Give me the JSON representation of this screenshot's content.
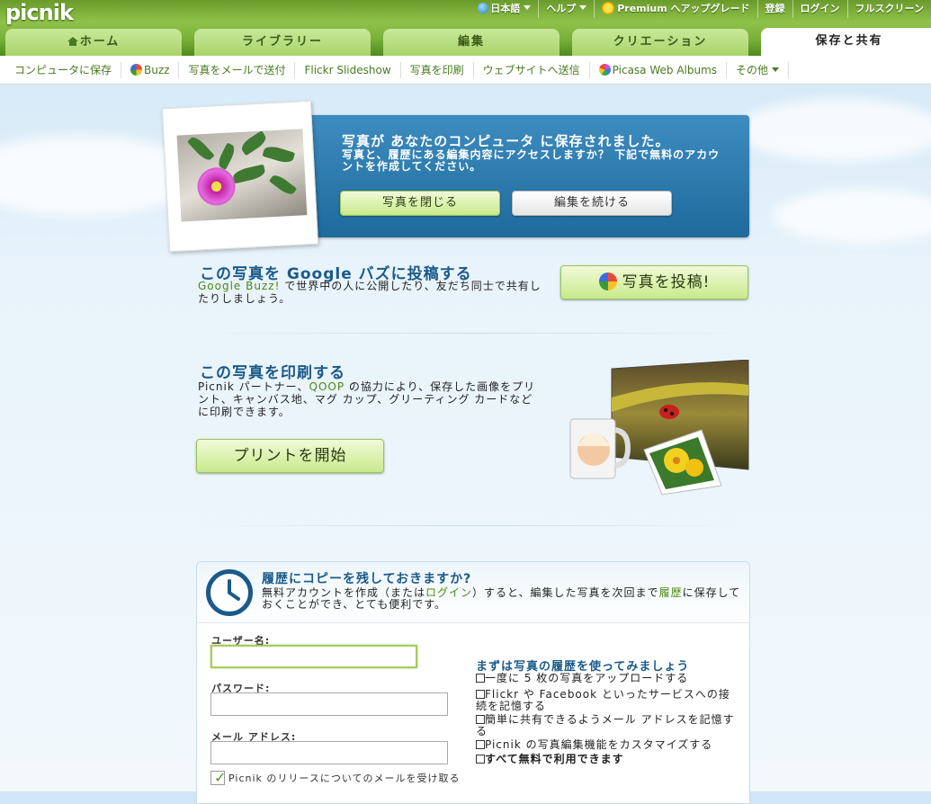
{
  "app": {
    "logo": "picnik"
  },
  "topnav": {
    "language": "日本語",
    "help": "ヘルプ",
    "premium": "Premium",
    "upgrade": "へアップグレード",
    "register": "登録",
    "login": "ログイン",
    "fullscreen": "フルスクリーン"
  },
  "tabs": [
    {
      "label": "ホーム"
    },
    {
      "label": "ライブラリー"
    },
    {
      "label": "編集"
    },
    {
      "label": "クリエーション"
    },
    {
      "label": "保存と共有",
      "active": true
    }
  ],
  "subnav": [
    {
      "label": "コンピュータに保存"
    },
    {
      "label": "Buzz",
      "icon": "buzz-icon"
    },
    {
      "label": "写真をメールで送付"
    },
    {
      "label": "Flickr Slideshow"
    },
    {
      "label": "写真を印刷"
    },
    {
      "label": "ウェブサイトへ送信"
    },
    {
      "label": "Picasa Web Albums",
      "icon": "picasa-icon"
    },
    {
      "label": "その他"
    }
  ],
  "saved": {
    "title": "写真が あなたのコンピュータ に保存されました。",
    "desc": "写真と、履歴にある編集内容にアクセスしますか？ 下記で無料のアカウントを作成してください。",
    "close_button": "写真を閉じる",
    "continue_button": "編集を続ける"
  },
  "buzz_section": {
    "title": "この写真を Google バズに投稿する",
    "link": "Google Buzz!",
    "text": " で世界中の人に公開したり、友だち同士で共有したりしましょう。",
    "button": "写真を投稿!"
  },
  "print_section": {
    "title": "この写真を印刷する",
    "text_before": "Picnik パートナー、",
    "link": "QOOP",
    "text_after": " の協力により、保存した画像をプリント、キャンバス地、マグ カップ、グリーティング カードなどに印刷できます。",
    "button": "プリントを開始"
  },
  "history": {
    "title": "履歴にコピーを残しておきますか?",
    "desc_before": "無料アカウントを作成（または",
    "desc_link": "ログイン",
    "desc_mid": "）すると、編集した写真を次回まで",
    "desc_link2": "履歴",
    "desc_after": "に保存しておくことができ、とても便利です。",
    "username_label": "ユーザー名:",
    "password_label": "パスワード:",
    "email_label": "メール アドレス:",
    "newsletter_label": "Picnik のリリースについてのメールを受け取る",
    "benefits_title": "まずは写真の履歴を使ってみましょう",
    "benefits": [
      "一度に 5 枚の写真をアップロードする",
      "Flickr や Facebook といったサービスへの接続を記憶する",
      "簡単に共有できるようメール アドレスを記憶する",
      "Picnik の写真編集機能をカスタマイズする",
      "すべて無料で利用できます"
    ]
  },
  "colors": {
    "accent_green": "#4a7a20",
    "panel_blue": "#1f6a9c",
    "title_blue": "#1a5a8a"
  }
}
